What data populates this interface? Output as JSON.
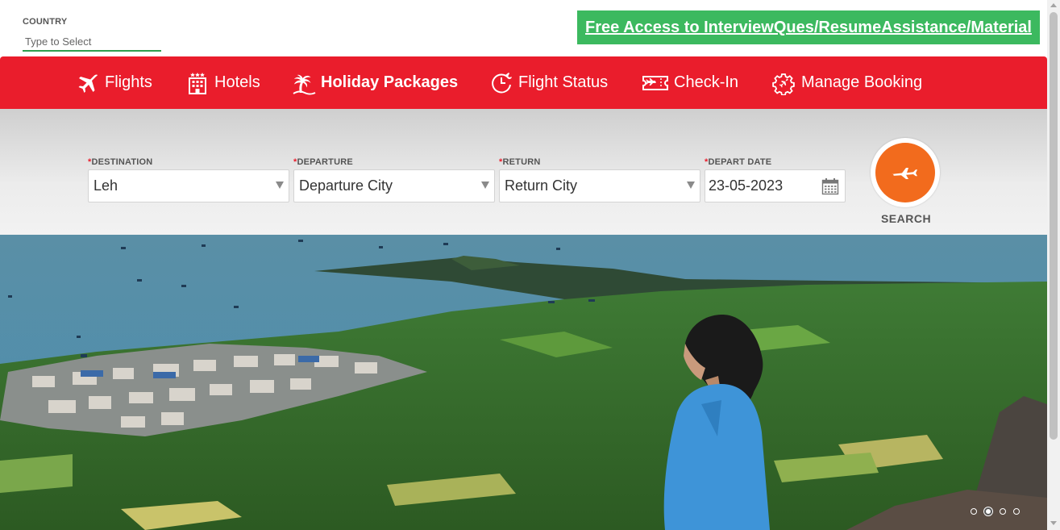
{
  "country": {
    "label": "COUNTRY",
    "placeholder": "Type to Select"
  },
  "promo": {
    "text": "Free Access to InterviewQues/ResumeAssistance/Material",
    "color": "#3cb95f"
  },
  "nav": {
    "color": "#ea1d2c",
    "items": [
      {
        "label": "Flights",
        "icon": "plane-icon"
      },
      {
        "label": "Hotels",
        "icon": "hotel-icon"
      },
      {
        "label": "Holiday Packages",
        "icon": "palm-tree-icon",
        "active": true
      },
      {
        "label": "Flight Status",
        "icon": "clock-plane-icon"
      },
      {
        "label": "Check-In",
        "icon": "ticket-icon"
      },
      {
        "label": "Manage Booking",
        "icon": "gear-plane-icon"
      }
    ]
  },
  "search": {
    "required_mark": "*",
    "destination": {
      "label": "DESTINATION",
      "value": "Leh"
    },
    "departure": {
      "label": "DEPARTURE",
      "value": "Departure City"
    },
    "return": {
      "label": "RETURN",
      "value": "Return City"
    },
    "depart_date": {
      "label": "DEPART DATE",
      "value": "23-05-2023"
    },
    "button_label": "SEARCH",
    "button_color": "#f26b1d"
  },
  "carousel": {
    "slide_count": 4,
    "active_index": 1
  }
}
